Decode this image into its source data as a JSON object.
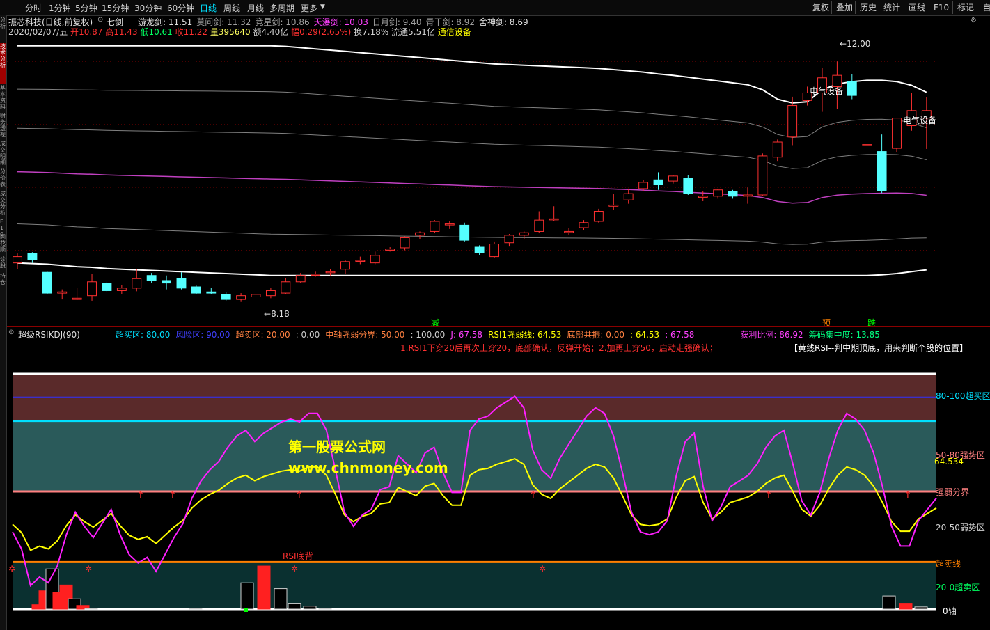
{
  "toolbar": {
    "timeframes": [
      "分时",
      "1分钟",
      "5分钟",
      "15分钟",
      "30分钟",
      "60分钟",
      "日线",
      "周线",
      "月线",
      "多周期",
      "更多"
    ],
    "active_timeframe": "日线",
    "right_buttons": [
      "复权",
      "叠加",
      "历史",
      "统计",
      "画线",
      "F10",
      "标记",
      "-自"
    ]
  },
  "left_strip": [
    "分析",
    "技术分析",
    "基本资料",
    "财务透视",
    "成交明细",
    "分价表",
    "成交分析",
    "F10",
    "同花顺",
    "诊股",
    "持仓"
  ],
  "stock_header": {
    "name": "振芯科技(日线,前复权)",
    "indicator_name": "七剑",
    "swords": [
      {
        "label": "游龙剑",
        "value": "11.51",
        "color": "#e0e0e0"
      },
      {
        "label": "莫问剑",
        "value": "11.32",
        "color": "#a0a0a0"
      },
      {
        "label": "竞星剑",
        "value": "10.86",
        "color": "#a0a0a0"
      },
      {
        "label": "天瀑剑",
        "value": "10.03",
        "color": "#ff40ff"
      },
      {
        "label": "日月剑",
        "value": "9.40",
        "color": "#a0a0a0"
      },
      {
        "label": "青干剑",
        "value": "8.92",
        "color": "#a0a0a0"
      },
      {
        "label": "舍神剑",
        "value": "8.69",
        "color": "#e0e0e0"
      }
    ]
  },
  "quote": {
    "date": "2020/02/07/五",
    "open_label": "开",
    "open": "10.87",
    "high_label": "高",
    "high": "11.43",
    "low_label": "低",
    "low": "10.61",
    "close_label": "收",
    "close": "11.22",
    "vol_label": "量",
    "volume": "395640",
    "amt_label": "额",
    "amount": "4.40亿",
    "change_label": "幅",
    "change": "0.29(2.65%)",
    "turnover_label": "换",
    "turnover": "7.18%",
    "float_label": "流通",
    "float": "5.51亿",
    "sector": "通信设备"
  },
  "main_annotations": {
    "high_marker": "12.00",
    "low_marker": "8.18",
    "sector_label_1": "电气设备",
    "sector_label_2": "电气设备",
    "signal_jian": "减",
    "signal_yu": "预",
    "signal_die": "跌"
  },
  "indicator_header": {
    "name": "超级RSIKDJ(90)",
    "items": [
      {
        "text": "超买区: 80.00",
        "color": "#00e0ff"
      },
      {
        "text": "风险区: 90.00",
        "color": "#4040ff"
      },
      {
        "text": "超卖区: 20.00",
        "color": "#ff8040"
      },
      {
        "text": ": 0.00",
        "color": "#d0d0d0"
      },
      {
        "text": "中轴强弱分界: 50.00",
        "color": "#ff8040"
      },
      {
        "text": ": 100.00",
        "color": "#d0d0d0"
      },
      {
        "text": "J: 67.58",
        "color": "#ff40ff"
      },
      {
        "text": "RSI1强弱线: 64.53",
        "color": "#ffff00"
      },
      {
        "text": "底部共振: 0.00",
        "color": "#ff8040"
      },
      {
        "text": ": 64.53",
        "color": "#ffff00"
      },
      {
        "text": ": 67.58",
        "color": "#ff40ff"
      },
      {
        "text": "获利比例: 86.92",
        "color": "#ff40ff"
      },
      {
        "text": "筹码集中度: 13.85",
        "color": "#00ff80"
      }
    ],
    "description": "1.RSI1下穿20后再次上穿20，底部确认，反弹开始；2.加再上穿50，启动走强确认；",
    "note": "【黄线RSI--判中期顶底，用来判断个股的位置】"
  },
  "indicator_right_labels": {
    "overbought_zone": "80-100超买区",
    "strong_zone": "50-80强势区",
    "current_value": "64.534",
    "divide": "强弱分界",
    "weak_zone": "20-50弱势区",
    "oversold_line": "超卖线",
    "oversold_zone": "20-0超卖区",
    "axis_zero": "0轴"
  },
  "indicator_annotations": {
    "rsi_bottom_div": "RSI底背"
  },
  "watermark": {
    "line1": "第一股票公式网",
    "line2": "www.chnmoney.com"
  },
  "colors": {
    "up": "#ff3030",
    "down": "#54ffff",
    "rsi_line": "#ffff00",
    "j_line": "#ff20ff"
  },
  "chart_data": {
    "type": "candlestick",
    "candles": [
      {
        "o": 8.8,
        "h": 8.95,
        "l": 8.7,
        "c": 8.9
      },
      {
        "o": 8.95,
        "h": 8.97,
        "l": 8.8,
        "c": 8.85
      },
      {
        "o": 8.65,
        "h": 8.66,
        "l": 8.3,
        "c": 8.32
      },
      {
        "o": 8.32,
        "h": 8.38,
        "l": 8.22,
        "c": 8.34
      },
      {
        "o": 8.22,
        "h": 8.4,
        "l": 8.21,
        "c": 8.24
      },
      {
        "o": 8.28,
        "h": 8.62,
        "l": 8.2,
        "c": 8.5
      },
      {
        "o": 8.48,
        "h": 8.5,
        "l": 8.34,
        "c": 8.36
      },
      {
        "o": 8.36,
        "h": 8.45,
        "l": 8.3,
        "c": 8.4
      },
      {
        "o": 8.4,
        "h": 8.7,
        "l": 8.35,
        "c": 8.55
      },
      {
        "o": 8.6,
        "h": 8.64,
        "l": 8.48,
        "c": 8.52
      },
      {
        "o": 8.52,
        "h": 8.6,
        "l": 8.38,
        "c": 8.48
      },
      {
        "o": 8.55,
        "h": 8.65,
        "l": 8.38,
        "c": 8.4
      },
      {
        "o": 8.42,
        "h": 8.44,
        "l": 8.3,
        "c": 8.32
      },
      {
        "o": 8.34,
        "h": 8.4,
        "l": 8.3,
        "c": 8.32
      },
      {
        "o": 8.3,
        "h": 8.34,
        "l": 8.2,
        "c": 8.22
      },
      {
        "o": 8.22,
        "h": 8.32,
        "l": 8.18,
        "c": 8.28
      },
      {
        "o": 8.26,
        "h": 8.34,
        "l": 8.22,
        "c": 8.3
      },
      {
        "o": 8.28,
        "h": 8.4,
        "l": 8.24,
        "c": 8.36
      },
      {
        "o": 8.32,
        "h": 8.56,
        "l": 8.3,
        "c": 8.5
      },
      {
        "o": 8.5,
        "h": 8.64,
        "l": 8.48,
        "c": 8.6
      },
      {
        "o": 8.62,
        "h": 8.66,
        "l": 8.58,
        "c": 8.62
      },
      {
        "o": 8.66,
        "h": 8.7,
        "l": 8.6,
        "c": 8.66
      },
      {
        "o": 8.7,
        "h": 8.85,
        "l": 8.62,
        "c": 8.82
      },
      {
        "o": 8.84,
        "h": 8.9,
        "l": 8.78,
        "c": 8.84
      },
      {
        "o": 8.8,
        "h": 8.98,
        "l": 8.78,
        "c": 8.92
      },
      {
        "o": 9.0,
        "h": 9.05,
        "l": 8.98,
        "c": 9.02
      },
      {
        "o": 9.04,
        "h": 9.22,
        "l": 9.0,
        "c": 9.2
      },
      {
        "o": 9.24,
        "h": 9.3,
        "l": 9.18,
        "c": 9.28
      },
      {
        "o": 9.3,
        "h": 9.48,
        "l": 9.28,
        "c": 9.46
      },
      {
        "o": 9.42,
        "h": 9.46,
        "l": 9.34,
        "c": 9.42
      },
      {
        "o": 9.4,
        "h": 9.44,
        "l": 9.14,
        "c": 9.16
      },
      {
        "o": 9.05,
        "h": 9.08,
        "l": 8.92,
        "c": 8.96
      },
      {
        "o": 8.9,
        "h": 9.14,
        "l": 8.88,
        "c": 9.1
      },
      {
        "o": 9.12,
        "h": 9.26,
        "l": 9.06,
        "c": 9.24
      },
      {
        "o": 9.24,
        "h": 9.3,
        "l": 9.18,
        "c": 9.28
      },
      {
        "o": 9.3,
        "h": 9.62,
        "l": 9.28,
        "c": 9.48
      },
      {
        "o": 9.5,
        "h": 9.7,
        "l": 9.46,
        "c": 9.5
      },
      {
        "o": 9.3,
        "h": 9.36,
        "l": 9.24,
        "c": 9.3
      },
      {
        "o": 9.36,
        "h": 9.48,
        "l": 9.32,
        "c": 9.44
      },
      {
        "o": 9.46,
        "h": 9.66,
        "l": 9.44,
        "c": 9.62
      },
      {
        "o": 9.7,
        "h": 9.9,
        "l": 9.64,
        "c": 9.72
      },
      {
        "o": 9.8,
        "h": 9.98,
        "l": 9.74,
        "c": 9.9
      },
      {
        "o": 9.98,
        "h": 10.12,
        "l": 9.94,
        "c": 10.08
      },
      {
        "o": 10.12,
        "h": 10.24,
        "l": 9.96,
        "c": 10.04
      },
      {
        "o": 10.1,
        "h": 10.2,
        "l": 10.06,
        "c": 10.18
      },
      {
        "o": 10.14,
        "h": 10.2,
        "l": 9.88,
        "c": 9.9
      },
      {
        "o": 9.84,
        "h": 9.94,
        "l": 9.78,
        "c": 9.86
      },
      {
        "o": 9.86,
        "h": 9.98,
        "l": 9.82,
        "c": 9.96
      },
      {
        "o": 9.94,
        "h": 9.96,
        "l": 9.82,
        "c": 9.86
      },
      {
        "o": 9.86,
        "h": 10.0,
        "l": 9.74,
        "c": 9.88
      },
      {
        "o": 9.88,
        "h": 10.54,
        "l": 9.86,
        "c": 10.5
      },
      {
        "o": 10.48,
        "h": 10.76,
        "l": 10.42,
        "c": 10.72
      },
      {
        "o": 10.8,
        "h": 11.44,
        "l": 10.66,
        "c": 11.3
      },
      {
        "o": 11.38,
        "h": 11.6,
        "l": 11.3,
        "c": 11.5
      },
      {
        "o": 11.5,
        "h": 11.9,
        "l": 11.2,
        "c": 11.74
      },
      {
        "o": 11.6,
        "h": 12.0,
        "l": 11.24,
        "c": 11.78
      },
      {
        "o": 11.68,
        "h": 11.8,
        "l": 11.4,
        "c": 11.46
      },
      {
        "o": 10.68,
        "h": 10.68,
        "l": 10.68,
        "c": 10.68
      },
      {
        "o": 10.57,
        "h": 10.84,
        "l": 9.91,
        "c": 9.95
      },
      {
        "o": 10.62,
        "h": 11.1,
        "l": 10.56,
        "c": 11.1
      },
      {
        "o": 10.98,
        "h": 11.5,
        "l": 10.9,
        "c": 11.22
      },
      {
        "o": 11.1,
        "h": 11.43,
        "l": 10.61,
        "c": 11.22
      }
    ],
    "bands": [
      {
        "name": "舍神剑",
        "color": "#ffffff",
        "values": [
          8.8,
          8.79,
          8.78,
          8.76,
          8.74,
          8.73,
          8.71,
          8.7,
          8.69,
          8.68,
          8.67,
          8.66,
          8.65,
          8.64,
          8.63,
          8.62,
          8.61,
          8.6,
          8.6,
          8.6,
          8.6,
          8.6,
          8.6,
          8.6,
          8.6,
          8.6,
          8.6,
          8.6,
          8.6,
          8.6,
          8.6,
          8.6,
          8.6,
          8.6,
          8.6,
          8.6,
          8.6,
          8.6,
          8.6,
          8.6,
          8.6,
          8.6,
          8.6,
          8.6,
          8.6,
          8.6,
          8.6,
          8.6,
          8.6,
          8.6,
          8.6,
          8.6,
          8.6,
          8.6,
          8.6,
          8.6,
          8.6,
          8.6,
          8.61,
          8.63,
          8.66,
          8.69
        ]
      },
      {
        "name": "游龙剑",
        "color": "#ffffff",
        "values": [
          12.25,
          12.25,
          12.25,
          12.25,
          12.25,
          12.25,
          12.25,
          12.25,
          12.25,
          12.25,
          12.25,
          12.25,
          12.25,
          12.25,
          12.25,
          12.25,
          12.25,
          12.25,
          12.24,
          12.22,
          12.2,
          12.18,
          12.16,
          12.14,
          12.12,
          12.1,
          12.08,
          12.06,
          12.04,
          12.02,
          12.0,
          11.98,
          11.96,
          11.95,
          11.94,
          11.93,
          11.92,
          11.91,
          11.9,
          11.89,
          11.87,
          11.85,
          11.83,
          11.8,
          11.78,
          11.75,
          11.72,
          11.69,
          11.66,
          11.63,
          11.55,
          11.4,
          11.34,
          11.36,
          11.55,
          11.64,
          11.68,
          11.7,
          11.7,
          11.68,
          11.62,
          11.51
        ]
      }
    ],
    "rsi": [
      64,
      58,
      45,
      48,
      46,
      52,
      63,
      71,
      66,
      62,
      67,
      72,
      63,
      56,
      53,
      55,
      50,
      56,
      62,
      67,
      76,
      82,
      86,
      89,
      94,
      98,
      100,
      96,
      99,
      101,
      103,
      104,
      103,
      106,
      106,
      100,
      86,
      71,
      66,
      70,
      72,
      79,
      80,
      91,
      88,
      85,
      92,
      94,
      85,
      78,
      78,
      100,
      104,
      105,
      108,
      110,
      112,
      108,
      93,
      86,
      83,
      90,
      95,
      100,
      105,
      108,
      106,
      98,
      85,
      71,
      64,
      63,
      64,
      68,
      84,
      96,
      99,
      80,
      68,
      73,
      80,
      82,
      84,
      88,
      94,
      98,
      100,
      88,
      75,
      70,
      78,
      90,
      100,
      106,
      104,
      100,
      92,
      80,
      66,
      59,
      59,
      68,
      72,
      76
    ]
  }
}
